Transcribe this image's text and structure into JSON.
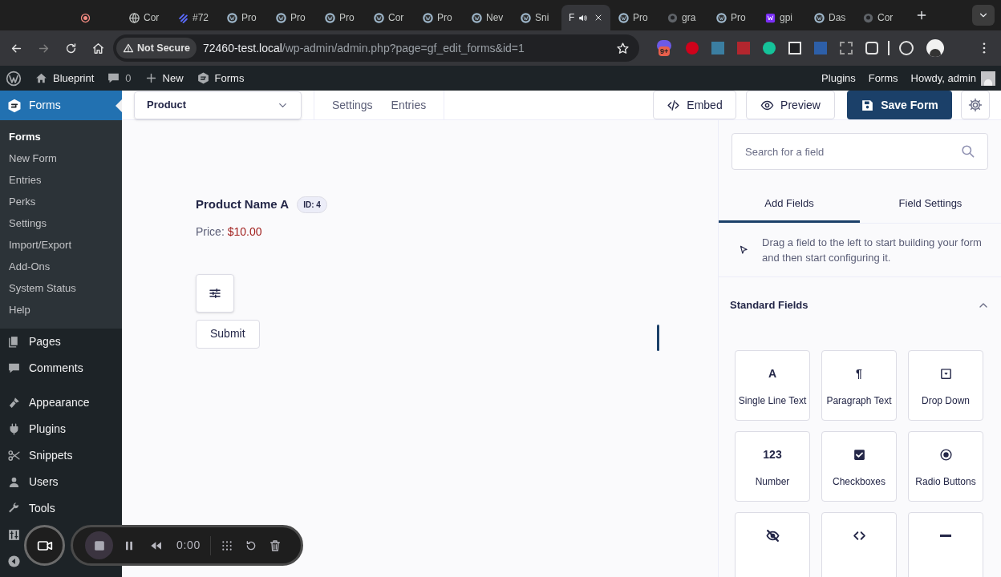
{
  "browser": {
    "tabs": [
      {
        "kind": "record",
        "selected": false
      },
      {
        "kind": "globe",
        "label": "Cor",
        "selected": false
      },
      {
        "kind": "stripes",
        "label": "#72",
        "selected": false
      },
      {
        "kind": "wordpress",
        "label": "Pro",
        "selected": false
      },
      {
        "kind": "wordpress",
        "label": "Pro",
        "selected": false
      },
      {
        "kind": "wordpress",
        "label": "Pro",
        "selected": false
      },
      {
        "kind": "wordpress",
        "label": "Cor",
        "selected": false
      },
      {
        "kind": "wordpress",
        "label": "Pro",
        "selected": false
      },
      {
        "kind": "wordpress",
        "label": "Nev",
        "selected": false
      },
      {
        "kind": "wordpress",
        "label": "Sni",
        "selected": false
      },
      {
        "kind": "audio",
        "label": "F",
        "selected": true
      },
      {
        "kind": "wordpress",
        "label": "Pro",
        "selected": false
      },
      {
        "kind": "github",
        "label": "gra",
        "selected": false
      },
      {
        "kind": "wordpress",
        "label": "Pro",
        "selected": false
      },
      {
        "kind": "tile",
        "label": "gpi",
        "selected": false
      },
      {
        "kind": "wordpress",
        "label": "Das",
        "selected": false
      },
      {
        "kind": "github",
        "label": "Cor",
        "selected": false
      }
    ],
    "security": "Not Secure",
    "host": "72460-test.local",
    "path": "/wp-admin/admin.php?page=gf_edit_forms&id=1",
    "extension_badge": "9+"
  },
  "admin_bar": {
    "site": "Blueprint",
    "comments": "0",
    "new": "New",
    "forms": "Forms",
    "right": [
      "Plugins",
      "Forms"
    ],
    "howdy": "Howdy, admin"
  },
  "sidebar": {
    "current": {
      "label": "Forms",
      "selected": true,
      "children": [
        {
          "label": "Forms",
          "selected": true
        },
        {
          "label": "New Form",
          "selected": false
        },
        {
          "label": "Entries",
          "selected": false
        },
        {
          "label": "Perks",
          "selected": false
        },
        {
          "label": "Settings",
          "selected": false
        },
        {
          "label": "Import/Export",
          "selected": false
        },
        {
          "label": "Add-Ons",
          "selected": false
        },
        {
          "label": "System Status",
          "selected": false
        },
        {
          "label": "Help",
          "selected": false
        }
      ]
    },
    "items": [
      {
        "kind": "pages",
        "label": "Pages",
        "selected": false
      },
      {
        "kind": "comments",
        "label": "Comments",
        "selected": false
      },
      {
        "kind": "appearance",
        "label": "Appearance",
        "selected": false
      },
      {
        "kind": "plugins",
        "label": "Plugins",
        "selected": false
      },
      {
        "kind": "snippets",
        "label": "Snippets",
        "selected": false
      },
      {
        "kind": "users",
        "label": "Users",
        "selected": false
      },
      {
        "kind": "tools",
        "label": "Tools",
        "selected": false
      },
      {
        "kind": "settings",
        "selected": false
      },
      {
        "kind": "collapse",
        "selected": false
      }
    ]
  },
  "toolbar": {
    "form_select": "Product",
    "links": [
      "Settings",
      "Entries"
    ],
    "embed": "Embed",
    "preview": "Preview",
    "save": "Save Form"
  },
  "canvas": {
    "field_title": "Product Name A",
    "field_id": "ID: 4",
    "price_label": "Price:",
    "price": "$10.00",
    "submit": "Submit"
  },
  "panel": {
    "search_placeholder": "Search for a field",
    "tabs": [
      {
        "label": "Add Fields",
        "selected": true
      },
      {
        "label": "Field Settings",
        "selected": false
      }
    ],
    "help": "Drag a field to the left to start building your form and then start configuring it.",
    "section": {
      "title": "Standard Fields",
      "expanded": true,
      "fields": [
        {
          "kind": "text",
          "icon_text": "A",
          "label": "Single Line Text"
        },
        {
          "kind": "text",
          "icon_text": "¶",
          "label": "Paragraph Text"
        },
        {
          "kind": "dropdown",
          "label": "Drop Down"
        },
        {
          "kind": "text",
          "icon_text": "123",
          "label": "Number"
        },
        {
          "kind": "checkbox",
          "label": "Checkboxes"
        },
        {
          "kind": "radio",
          "label": "Radio Buttons"
        },
        {
          "kind": "hidden"
        },
        {
          "kind": "html"
        },
        {
          "kind": "section"
        }
      ]
    }
  },
  "recorder": {
    "time": "0:00"
  }
}
